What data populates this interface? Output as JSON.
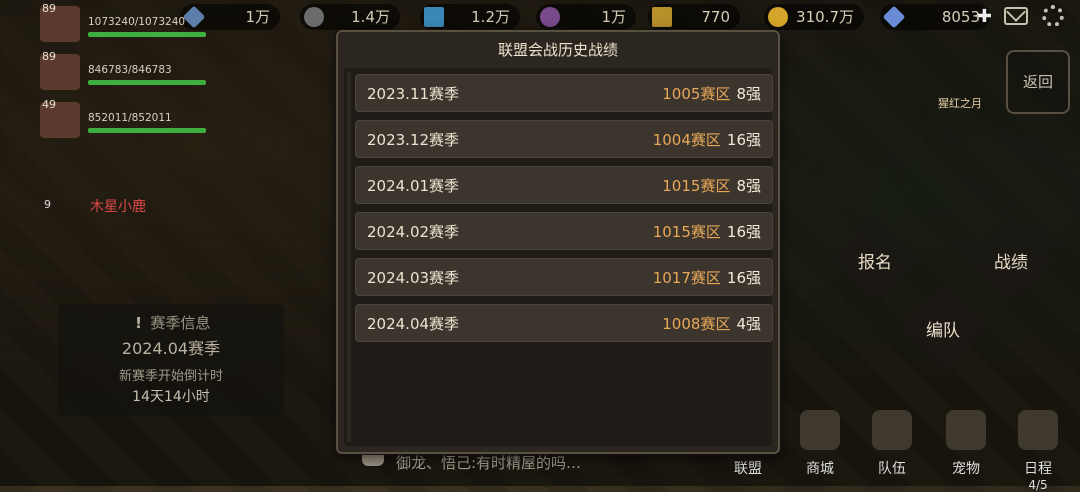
{
  "resources": [
    {
      "icon": "stone-icon",
      "value": "1万"
    },
    {
      "icon": "ore-icon",
      "value": "1.4万"
    },
    {
      "icon": "crystal-icon",
      "value": "1.2万"
    },
    {
      "icon": "wood-icon",
      "value": "1万"
    },
    {
      "icon": "wheat-icon",
      "value": "770"
    },
    {
      "icon": "gold-coin-icon",
      "value": "310.7万"
    },
    {
      "icon": "diamond-icon",
      "value": "8053"
    }
  ],
  "players": [
    {
      "level": "89",
      "hp": "1073240/1073240",
      "hp_fraction": 1.0
    },
    {
      "level": "89",
      "hp": "846783/846783",
      "hp_fraction": 1.0
    },
    {
      "level": "49",
      "hp": "852011/852011",
      "hp_fraction": 1.0
    }
  ],
  "map_labels": {
    "named_player": "木星小鹿",
    "named_level": "9",
    "right_building": "猩红之月"
  },
  "season_info": {
    "header": "赛季信息",
    "season": "2024.04赛季",
    "countdown_label": "新赛季开始倒计时",
    "countdown": "14天14小时"
  },
  "back_label": "返回",
  "actions": {
    "signup": "报名",
    "record": "战绩",
    "formation": "编队"
  },
  "chat": {
    "message": "御龙、悟己:有时精屋的吗…"
  },
  "bottom_nav": [
    {
      "label": "联盟"
    },
    {
      "label": "商城"
    },
    {
      "label": "队伍"
    },
    {
      "label": "宠物"
    },
    {
      "label": "日程",
      "page": "4/5"
    }
  ],
  "modal": {
    "title": "联盟会战历史战绩",
    "records": [
      {
        "season": "2023.11赛季",
        "zone": "1005赛区",
        "rank": "8强"
      },
      {
        "season": "2023.12赛季",
        "zone": "1004赛区",
        "rank": "16强"
      },
      {
        "season": "2024.01赛季",
        "zone": "1015赛区",
        "rank": "8强"
      },
      {
        "season": "2024.02赛季",
        "zone": "1015赛区",
        "rank": "16强"
      },
      {
        "season": "2024.03赛季",
        "zone": "1017赛区",
        "rank": "16强"
      },
      {
        "season": "2024.04赛季",
        "zone": "1008赛区",
        "rank": "4强"
      }
    ]
  }
}
